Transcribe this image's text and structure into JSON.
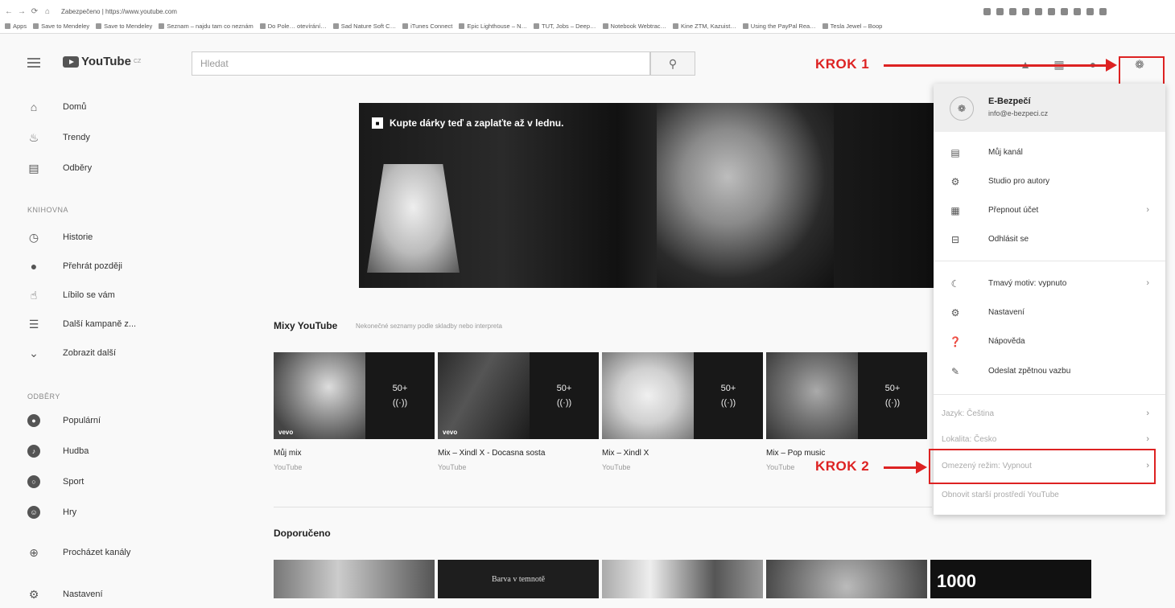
{
  "browser": {
    "url": "Zabezpečeno | https://www.youtube.com",
    "bookmarks": [
      "Apps",
      "Save to Mendeley",
      "Save to Mendeley",
      "Seznam – najdu tam co neznám",
      "Do Pole… otevírání…",
      "Sad Nature Soft C…",
      "iTunes Connect",
      "Epic Lighthouse – N…",
      "TUT, Jobs – Deep…",
      "Notebook Webtrac…",
      "Kine ZTM, Kazuist…",
      "Using the PayPal Rea…",
      "Tesla Jewel – Boop"
    ]
  },
  "masthead": {
    "logo": "YouTube",
    "logo_suffix": "CZ",
    "search_placeholder": "Hledat"
  },
  "annotations": {
    "krok1": "KROK 1",
    "krok2": "KROK 2",
    "color": "#d22222"
  },
  "sidebar": {
    "items_top": [
      {
        "icon": "home-icon",
        "label": "Domů"
      },
      {
        "icon": "trending-icon",
        "label": "Trendy"
      },
      {
        "icon": "subscriptions-icon",
        "label": "Odběry"
      }
    ],
    "library_heading": "KNIHOVNA",
    "library_items": [
      {
        "icon": "history-icon",
        "label": "Historie"
      },
      {
        "icon": "watch-later-icon",
        "label": "Přehrát později"
      },
      {
        "icon": "liked-icon",
        "label": "Líbilo se vám"
      },
      {
        "icon": "playlist-icon",
        "label": "Další kampaně z..."
      },
      {
        "icon": "chevron-down-icon",
        "label": "Zobrazit další"
      }
    ],
    "subs_heading": "ODBĚRY",
    "subs_items": [
      {
        "icon": "popular-icon",
        "label": "Populární"
      },
      {
        "icon": "music-icon",
        "label": "Hudba"
      },
      {
        "icon": "sport-icon",
        "label": "Sport"
      },
      {
        "icon": "games-icon",
        "label": "Hry"
      }
    ],
    "browse_channels": "Procházet kanály",
    "settings": "Nastavení"
  },
  "banner": {
    "caption": "Kupte dárky teď a zaplaťte až v lednu."
  },
  "mixes": {
    "title": "Mixy YouTube",
    "subtitle": "Nekonečné seznamy podle skladby nebo interpreta",
    "videos": [
      {
        "title": "Můj mix",
        "channel": "YouTube",
        "count": "50+",
        "vevo": "vevo"
      },
      {
        "title": "Mix – Xindl X - Docasna sosta",
        "channel": "YouTube",
        "count": "50+",
        "vevo": "vevo"
      },
      {
        "title": "Mix – Xindl X",
        "channel": "YouTube",
        "count": "50+",
        "vevo": ""
      },
      {
        "title": "Mix – Pop music",
        "channel": "YouTube",
        "count": "50+",
        "vevo": ""
      }
    ]
  },
  "recommended": {
    "title": "Doporučeno",
    "thumb_texts": [
      "",
      "Barva v temnotě",
      "",
      "",
      "1000"
    ]
  },
  "account_menu": {
    "name": "E-Bezpečí",
    "email": "info@e-bezpeci.cz",
    "items_1": [
      {
        "icon": "channel-icon",
        "label": "Můj kanál",
        "chevron": false
      },
      {
        "icon": "gear-icon",
        "label": "Studio pro autory",
        "chevron": false
      },
      {
        "icon": "switch-account-icon",
        "label": "Přepnout účet",
        "chevron": true
      },
      {
        "icon": "sign-out-icon",
        "label": "Odhlásit se",
        "chevron": false
      }
    ],
    "items_2": [
      {
        "icon": "moon-icon",
        "label": "Tmavý motiv: vypnuto",
        "chevron": true
      },
      {
        "icon": "gear-icon",
        "label": "Nastavení",
        "chevron": false
      },
      {
        "icon": "help-icon",
        "label": "Nápověda",
        "chevron": false
      },
      {
        "icon": "feedback-icon",
        "label": "Odeslat zpětnou vazbu",
        "chevron": false
      }
    ],
    "items_3": [
      {
        "label": "Jazyk: Čeština",
        "chevron": true
      },
      {
        "label": "Lokalita: Česko",
        "chevron": true
      },
      {
        "label": "Omezený režim: Vypnout",
        "chevron": true
      },
      {
        "label": "Obnovit starší prostředí YouTube",
        "chevron": false
      }
    ]
  }
}
